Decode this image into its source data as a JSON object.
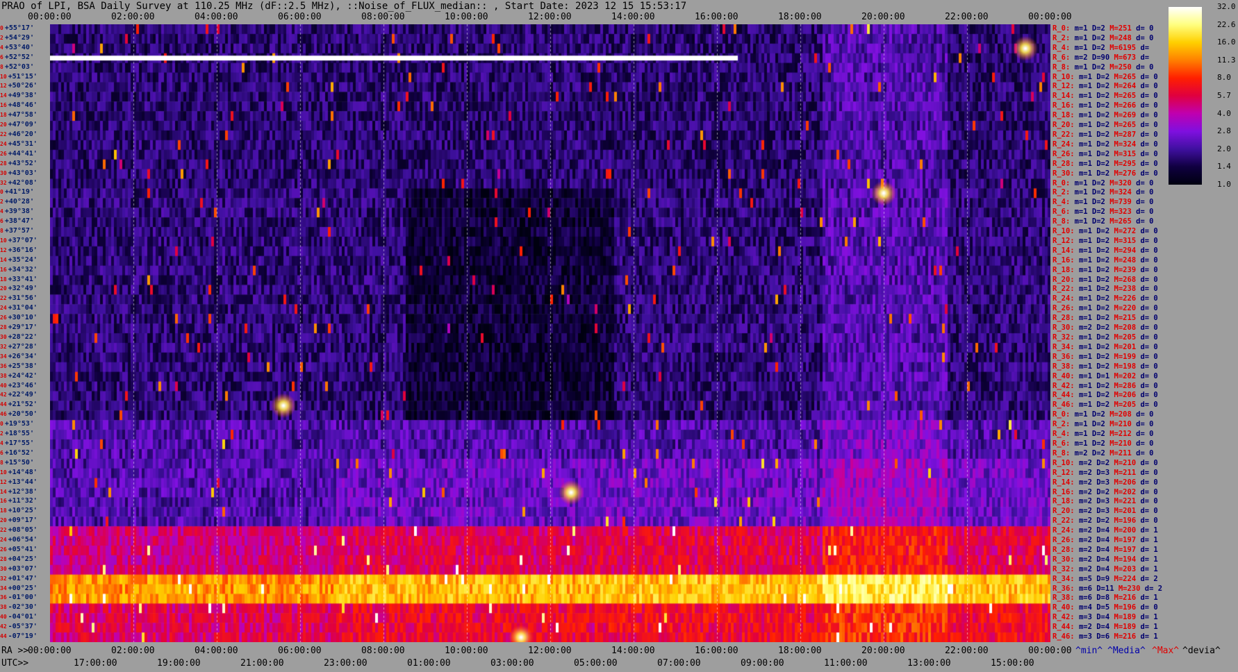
{
  "title": "PRAO of LPI, BSA Daily Survey at 110.25 MHz (dF::2.5 MHz), ::Noise_of_FLUX_median:: , Start Date: 2023 12 15 15:53:17",
  "top_axis_ticks": [
    "00:00:00",
    "02:00:00",
    "04:00:00",
    "06:00:00",
    "08:00:00",
    "10:00:00",
    "12:00:00",
    "14:00:00",
    "16:00:00",
    "18:00:00",
    "20:00:00",
    "22:00:00",
    "00:00:00"
  ],
  "ra_axis": {
    "label": "RA >>",
    "ticks": [
      "00:00:00",
      "02:00:00",
      "04:00:00",
      "06:00:00",
      "08:00:00",
      "10:00:00",
      "12:00:00",
      "14:00:00",
      "16:00:00",
      "18:00:00",
      "20:00:00",
      "22:00:00",
      "00:00:00"
    ]
  },
  "utc_axis": {
    "label": "UTC>>",
    "ticks": [
      "17:00:00",
      "19:00:00",
      "21:00:00",
      "23:00:00",
      "01:00:00",
      "03:00:00",
      "05:00:00",
      "07:00:00",
      "09:00:00",
      "11:00:00",
      "13:00:00",
      "15:00:00"
    ]
  },
  "legend_footer": {
    "min": "^min^",
    "median": "^Media^",
    "max": "^Max^",
    "devia": "^devia^"
  },
  "colorbar": {
    "ticks": [
      "32.0",
      "22.6",
      "16.0",
      "11.3",
      "8.0",
      "5.7",
      "4.0",
      "2.8",
      "2.0",
      "1.4",
      "1.0"
    ],
    "colors": [
      "#ffffff",
      "#ffff80",
      "#ffd000",
      "#ff8000",
      "#ff2000",
      "#e00040",
      "#c000b0",
      "#8010e0",
      "#4010a0",
      "#100040",
      "#000010"
    ]
  },
  "declinations": [
    {
      "i": "0",
      "d": "+55°17'"
    },
    {
      "i": "2",
      "d": "+54°29'"
    },
    {
      "i": "4",
      "d": "+53°40'"
    },
    {
      "i": "6",
      "d": "+52°52'"
    },
    {
      "i": "8",
      "d": "+52°03'"
    },
    {
      "i": "10",
      "d": "+51°15'"
    },
    {
      "i": "12",
      "d": "+50°26'"
    },
    {
      "i": "14",
      "d": "+49°38'"
    },
    {
      "i": "16",
      "d": "+48°46'"
    },
    {
      "i": "18",
      "d": "+47°58'"
    },
    {
      "i": "20",
      "d": "+47°09'"
    },
    {
      "i": "22",
      "d": "+46°20'"
    },
    {
      "i": "24",
      "d": "+45°31'"
    },
    {
      "i": "26",
      "d": "+44°41'"
    },
    {
      "i": "28",
      "d": "+43°52'"
    },
    {
      "i": "30",
      "d": "+43°03'"
    },
    {
      "i": "32",
      "d": "+42°08'"
    },
    {
      "i": "0",
      "d": "+41°19'"
    },
    {
      "i": "2",
      "d": "+40°28'"
    },
    {
      "i": "4",
      "d": "+39°38'"
    },
    {
      "i": "6",
      "d": "+38°47'"
    },
    {
      "i": "8",
      "d": "+37°57'"
    },
    {
      "i": "10",
      "d": "+37°07'"
    },
    {
      "i": "12",
      "d": "+36°16'"
    },
    {
      "i": "14",
      "d": "+35°24'"
    },
    {
      "i": "16",
      "d": "+34°32'"
    },
    {
      "i": "18",
      "d": "+33°41'"
    },
    {
      "i": "20",
      "d": "+32°49'"
    },
    {
      "i": "22",
      "d": "+31°56'"
    },
    {
      "i": "24",
      "d": "+31°04'"
    },
    {
      "i": "26",
      "d": "+30°10'"
    },
    {
      "i": "28",
      "d": "+29°17'"
    },
    {
      "i": "30",
      "d": "+28°22'"
    },
    {
      "i": "32",
      "d": "+27°28'"
    },
    {
      "i": "34",
      "d": "+26°34'"
    },
    {
      "i": "36",
      "d": "+25°38'"
    },
    {
      "i": "38",
      "d": "+24°42'"
    },
    {
      "i": "40",
      "d": "+23°46'"
    },
    {
      "i": "42",
      "d": "+22°49'"
    },
    {
      "i": "44",
      "d": "+21°52'"
    },
    {
      "i": "46",
      "d": "+20°50'"
    },
    {
      "i": "0",
      "d": "+19°53'"
    },
    {
      "i": "2",
      "d": "+18°55'"
    },
    {
      "i": "4",
      "d": "+17°55'"
    },
    {
      "i": "6",
      "d": "+16°52'"
    },
    {
      "i": "8",
      "d": "+15°50'"
    },
    {
      "i": "10",
      "d": "+14°48'"
    },
    {
      "i": "12",
      "d": "+13°44'"
    },
    {
      "i": "14",
      "d": "+12°38'"
    },
    {
      "i": "16",
      "d": "+11°32'"
    },
    {
      "i": "18",
      "d": "+10°25'"
    },
    {
      "i": "20",
      "d": "+09°17'"
    },
    {
      "i": "22",
      "d": "+08°05'"
    },
    {
      "i": "24",
      "d": "+06°54'"
    },
    {
      "i": "26",
      "d": "+05°41'"
    },
    {
      "i": "28",
      "d": "+04°25'"
    },
    {
      "i": "30",
      "d": "+03°07'"
    },
    {
      "i": "32",
      "d": "+01°47'"
    },
    {
      "i": "34",
      "d": "+00°25'"
    },
    {
      "i": "36",
      "d": "-01°00'"
    },
    {
      "i": "38",
      "d": "-02°30'"
    },
    {
      "i": "40",
      "d": "-04°01'"
    },
    {
      "i": "42",
      "d": "-05°37'"
    },
    {
      "i": "44",
      "d": "-07°19'"
    }
  ],
  "stats": [
    {
      "r": "R_0:",
      "m": "m=1",
      "D": "D=2",
      "M": "M=251",
      "d": "d= 0"
    },
    {
      "r": "R_2:",
      "m": "m=1",
      "D": "D=2",
      "M": "M=248",
      "d": "d= 0"
    },
    {
      "r": "R_4:",
      "m": "m=1",
      "D": "D=2",
      "M": "M=6195",
      "d": "d="
    },
    {
      "r": "R_6:",
      "m": "m=2",
      "D": "D=90",
      "M": "M=673",
      "d": "d="
    },
    {
      "r": "R_8:",
      "m": "m=1",
      "D": "D=2",
      "M": "M=250",
      "d": "d= 0"
    },
    {
      "r": "R_10:",
      "m": "m=1",
      "D": "D=2",
      "M": "M=265",
      "d": "d= 0"
    },
    {
      "r": "R_12:",
      "m": "m=1",
      "D": "D=2",
      "M": "M=264",
      "d": "d= 0"
    },
    {
      "r": "R_14:",
      "m": "m=1",
      "D": "D=2",
      "M": "M=265",
      "d": "d= 0"
    },
    {
      "r": "R_16:",
      "m": "m=1",
      "D": "D=2",
      "M": "M=266",
      "d": "d= 0"
    },
    {
      "r": "R_18:",
      "m": "m=1",
      "D": "D=2",
      "M": "M=269",
      "d": "d= 0"
    },
    {
      "r": "R_20:",
      "m": "m=1",
      "D": "D=2",
      "M": "M=265",
      "d": "d= 0"
    },
    {
      "r": "R_22:",
      "m": "m=1",
      "D": "D=2",
      "M": "M=287",
      "d": "d= 0"
    },
    {
      "r": "R_24:",
      "m": "m=1",
      "D": "D=2",
      "M": "M=324",
      "d": "d= 0"
    },
    {
      "r": "R_26:",
      "m": "m=1",
      "D": "D=2",
      "M": "M=315",
      "d": "d= 0"
    },
    {
      "r": "R_28:",
      "m": "m=1",
      "D": "D=2",
      "M": "M=295",
      "d": "d= 0"
    },
    {
      "r": "R_30:",
      "m": "m=1",
      "D": "D=2",
      "M": "M=276",
      "d": "d= 0"
    },
    {
      "r": "R_0:",
      "m": "m=1",
      "D": "D=2",
      "M": "M=320",
      "d": "d= 0"
    },
    {
      "r": "R_2:",
      "m": "m=1",
      "D": "D=2",
      "M": "M=324",
      "d": "d= 0"
    },
    {
      "r": "R_4:",
      "m": "m=1",
      "D": "D=2",
      "M": "M=739",
      "d": "d= 0"
    },
    {
      "r": "R_6:",
      "m": "m=1",
      "D": "D=2",
      "M": "M=323",
      "d": "d= 0"
    },
    {
      "r": "R_8:",
      "m": "m=1",
      "D": "D=2",
      "M": "M=265",
      "d": "d= 0"
    },
    {
      "r": "R_10:",
      "m": "m=1",
      "D": "D=2",
      "M": "M=272",
      "d": "d= 0"
    },
    {
      "r": "R_12:",
      "m": "m=1",
      "D": "D=2",
      "M": "M=315",
      "d": "d= 0"
    },
    {
      "r": "R_14:",
      "m": "m=1",
      "D": "D=2",
      "M": "M=294",
      "d": "d= 0"
    },
    {
      "r": "R_16:",
      "m": "m=1",
      "D": "D=2",
      "M": "M=248",
      "d": "d= 0"
    },
    {
      "r": "R_18:",
      "m": "m=1",
      "D": "D=2",
      "M": "M=239",
      "d": "d= 0"
    },
    {
      "r": "R_20:",
      "m": "m=1",
      "D": "D=2",
      "M": "M=268",
      "d": "d= 0"
    },
    {
      "r": "R_22:",
      "m": "m=1",
      "D": "D=2",
      "M": "M=238",
      "d": "d= 0"
    },
    {
      "r": "R_24:",
      "m": "m=1",
      "D": "D=2",
      "M": "M=226",
      "d": "d= 0"
    },
    {
      "r": "R_26:",
      "m": "m=1",
      "D": "D=2",
      "M": "M=220",
      "d": "d= 0"
    },
    {
      "r": "R_28:",
      "m": "m=1",
      "D": "D=2",
      "M": "M=215",
      "d": "d= 0"
    },
    {
      "r": "R_30:",
      "m": "m=2",
      "D": "D=2",
      "M": "M=208",
      "d": "d= 0"
    },
    {
      "r": "R_32:",
      "m": "m=1",
      "D": "D=2",
      "M": "M=205",
      "d": "d= 0"
    },
    {
      "r": "R_34:",
      "m": "m=1",
      "D": "D=2",
      "M": "M=201",
      "d": "d= 0"
    },
    {
      "r": "R_36:",
      "m": "m=1",
      "D": "D=2",
      "M": "M=199",
      "d": "d= 0"
    },
    {
      "r": "R_38:",
      "m": "m=1",
      "D": "D=2",
      "M": "M=198",
      "d": "d= 0"
    },
    {
      "r": "R_40:",
      "m": "m=1",
      "D": "D=1",
      "M": "M=202",
      "d": "d= 0"
    },
    {
      "r": "R_42:",
      "m": "m=1",
      "D": "D=2",
      "M": "M=286",
      "d": "d= 0"
    },
    {
      "r": "R_44:",
      "m": "m=1",
      "D": "D=2",
      "M": "M=206",
      "d": "d= 0"
    },
    {
      "r": "R_46:",
      "m": "m=1",
      "D": "D=2",
      "M": "M=205",
      "d": "d= 0"
    },
    {
      "r": "R_0:",
      "m": "m=1",
      "D": "D=2",
      "M": "M=208",
      "d": "d= 0"
    },
    {
      "r": "R_2:",
      "m": "m=1",
      "D": "D=2",
      "M": "M=210",
      "d": "d= 0"
    },
    {
      "r": "R_4:",
      "m": "m=1",
      "D": "D=2",
      "M": "M=212",
      "d": "d= 0"
    },
    {
      "r": "R_6:",
      "m": "m=1",
      "D": "D=2",
      "M": "M=210",
      "d": "d= 0"
    },
    {
      "r": "R_8:",
      "m": "m=2",
      "D": "D=2",
      "M": "M=211",
      "d": "d= 0"
    },
    {
      "r": "R_10:",
      "m": "m=2",
      "D": "D=2",
      "M": "M=210",
      "d": "d= 0"
    },
    {
      "r": "R_12:",
      "m": "m=2",
      "D": "D=3",
      "M": "M=211",
      "d": "d= 0"
    },
    {
      "r": "R_14:",
      "m": "m=2",
      "D": "D=3",
      "M": "M=206",
      "d": "d= 0"
    },
    {
      "r": "R_16:",
      "m": "m=2",
      "D": "D=2",
      "M": "M=202",
      "d": "d= 0"
    },
    {
      "r": "R_18:",
      "m": "m=2",
      "D": "D=3",
      "M": "M=221",
      "d": "d= 0"
    },
    {
      "r": "R_20:",
      "m": "m=2",
      "D": "D=3",
      "M": "M=201",
      "d": "d= 0"
    },
    {
      "r": "R_22:",
      "m": "m=2",
      "D": "D=2",
      "M": "M=196",
      "d": "d= 0"
    },
    {
      "r": "R_24:",
      "m": "m=2",
      "D": "D=4",
      "M": "M=200",
      "d": "d= 1"
    },
    {
      "r": "R_26:",
      "m": "m=2",
      "D": "D=4",
      "M": "M=197",
      "d": "d= 1"
    },
    {
      "r": "R_28:",
      "m": "m=2",
      "D": "D=4",
      "M": "M=197",
      "d": "d= 1"
    },
    {
      "r": "R_30:",
      "m": "m=2",
      "D": "D=4",
      "M": "M=194",
      "d": "d= 1"
    },
    {
      "r": "R_32:",
      "m": "m=2",
      "D": "D=4",
      "M": "M=203",
      "d": "d= 1"
    },
    {
      "r": "R_34:",
      "m": "m=5",
      "D": "D=9",
      "M": "M=224",
      "d": "d= 2"
    },
    {
      "r": "R_36:",
      "m": "m=6",
      "D": "D=11",
      "M": "M=230",
      "d": "d= 2"
    },
    {
      "r": "R_38:",
      "m": "m=6",
      "D": "D=8",
      "M": "M=216",
      "d": "d= 1"
    },
    {
      "r": "R_40:",
      "m": "m=4",
      "D": "D=5",
      "M": "M=196",
      "d": "d= 0"
    },
    {
      "r": "R_42:",
      "m": "m=3",
      "D": "D=4",
      "M": "M=189",
      "d": "d= 1"
    },
    {
      "r": "R_44:",
      "m": "m=2",
      "D": "D=4",
      "M": "M=189",
      "d": "d= 1"
    },
    {
      "r": "R_46:",
      "m": "m=3",
      "D": "D=6",
      "M": "M=216",
      "d": "d= 1"
    }
  ],
  "chart_data": {
    "type": "heatmap",
    "title": "PRAO of LPI, BSA Daily Survey at 110.25 MHz (dF::2.5 MHz), ::Noise_of_FLUX_median:: , Start Date: 2023 12 15 15:53:17",
    "x_axis": "RA (h)",
    "xlim": [
      0,
      24
    ],
    "y_axis": "declination",
    "ylim": [
      "+55°17'",
      "-07°19'"
    ],
    "value_scale": "log",
    "colorbar_range": [
      1.0,
      32.0
    ],
    "bright_features": [
      {
        "ra_h": 20.0,
        "dec": "+41°19'",
        "desc": "bright point source"
      },
      {
        "ra_h": 23.4,
        "dec": "+53°40'",
        "desc": "bright point source"
      },
      {
        "ra_h": 5.6,
        "dec": "+21°52'",
        "desc": "bright point source"
      },
      {
        "ra_h": 11.3,
        "dec": "-07°19'",
        "desc": "bright point source"
      },
      {
        "ra_h": 12.5,
        "dec": "+12°38'",
        "desc": "bright point source"
      }
    ],
    "saturated_row": {
      "dec": "+52°52'",
      "ra_range_h": [
        0,
        16.5
      ]
    },
    "band_rows_dec": [
      "+01°47'",
      "+00°25'",
      "-01°00'"
    ]
  }
}
